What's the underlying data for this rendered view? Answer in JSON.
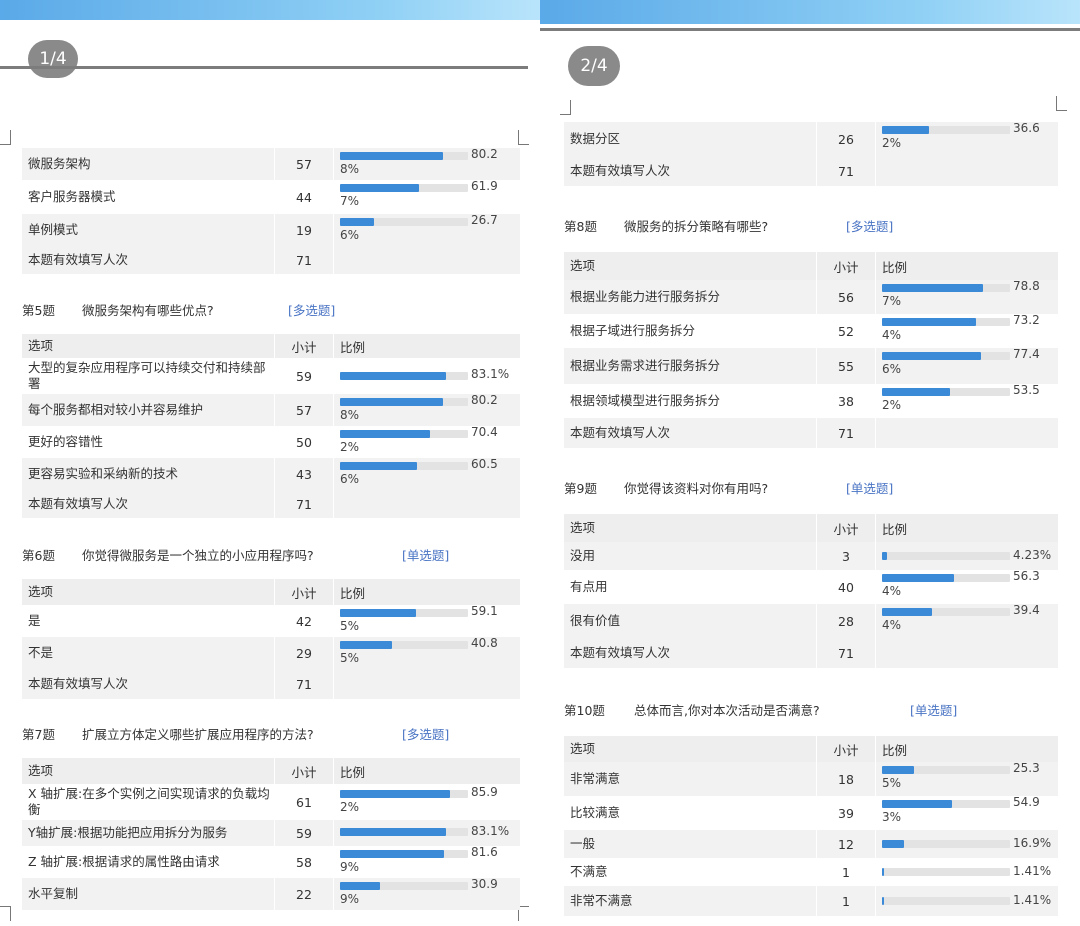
{
  "page1": {
    "page_number": "1/4",
    "sections": [
      {
        "rows": [
          {
            "option": "微服务架构",
            "count": "57",
            "pct": "80.2",
            "pct_tail": "8%",
            "fill": 0.802
          },
          {
            "option": "客户服务器模式",
            "count": "44",
            "pct": "61.9",
            "pct_tail": "7%",
            "fill": 0.619
          },
          {
            "option": "单例模式",
            "count": "19",
            "pct": "26.7",
            "pct_tail": "6%",
            "fill": 0.267
          }
        ],
        "total_label": "本题有效填写人次",
        "total": "71"
      },
      {
        "number": "第5题",
        "title": "微服务架构有哪些优点?",
        "type": "[多选题]",
        "header": {
          "option": "选项",
          "count": "小计",
          "ratio": "比例"
        },
        "rows": [
          {
            "option": "大型的复杂应用程序可以持续交付和持续部署",
            "count": "59",
            "pct": "83.1%",
            "pct_tail": "",
            "fill": 0.831
          },
          {
            "option": "每个服务都相对较小并容易维护",
            "count": "57",
            "pct": "80.2",
            "pct_tail": "8%",
            "fill": 0.802
          },
          {
            "option": "更好的容错性",
            "count": "50",
            "pct": "70.4",
            "pct_tail": "2%",
            "fill": 0.704
          },
          {
            "option": "更容易实验和采纳新的技术",
            "count": "43",
            "pct": "60.5",
            "pct_tail": "6%",
            "fill": 0.605
          }
        ],
        "total_label": "本题有效填写人次",
        "total": "71"
      },
      {
        "number": "第6题",
        "title": "你觉得微服务是一个独立的小应用程序吗?",
        "type": "[单选题]",
        "header": {
          "option": "选项",
          "count": "小计",
          "ratio": "比例"
        },
        "rows": [
          {
            "option": "是",
            "count": "42",
            "pct": "59.1",
            "pct_tail": "5%",
            "fill": 0.591
          },
          {
            "option": "不是",
            "count": "29",
            "pct": "40.8",
            "pct_tail": "5%",
            "fill": 0.408
          }
        ],
        "total_label": "本题有效填写人次",
        "total": "71"
      },
      {
        "number": "第7题",
        "title": "扩展立方体定义哪些扩展应用程序的方法?",
        "type": "[多选题]",
        "header": {
          "option": "选项",
          "count": "小计",
          "ratio": "比例"
        },
        "rows": [
          {
            "option": "X 轴扩展:在多个实例之间实现请求的负载均衡",
            "count": "61",
            "pct": "85.9",
            "pct_tail": "2%",
            "fill": 0.859
          },
          {
            "option": "Y轴扩展:根据功能把应用拆分为服务",
            "count": "59",
            "pct": "83.1%",
            "pct_tail": "",
            "fill": 0.831
          },
          {
            "option": "Z 轴扩展:根据请求的属性路由请求",
            "count": "58",
            "pct": "81.6",
            "pct_tail": "9%",
            "fill": 0.816
          },
          {
            "option": "水平复制",
            "count": "22",
            "pct": "30.9",
            "pct_tail": "9%",
            "fill": 0.309
          }
        ]
      }
    ]
  },
  "page2": {
    "page_number": "2/4",
    "sections": [
      {
        "rows": [
          {
            "option": "数据分区",
            "count": "26",
            "pct": "36.6",
            "pct_tail": "2%",
            "fill": 0.366
          }
        ],
        "total_label": "本题有效填写人次",
        "total": "71"
      },
      {
        "number": "第8题",
        "title": "微服务的拆分策略有哪些?",
        "type": "[多选题]",
        "header": {
          "option": "选项",
          "count": "小计",
          "ratio": "比例"
        },
        "rows": [
          {
            "option": "根据业务能力进行服务拆分",
            "count": "56",
            "pct": "78.8",
            "pct_tail": "7%",
            "fill": 0.788
          },
          {
            "option": "根据子域进行服务拆分",
            "count": "52",
            "pct": "73.2",
            "pct_tail": "4%",
            "fill": 0.732
          },
          {
            "option": "根据业务需求进行服务拆分",
            "count": "55",
            "pct": "77.4",
            "pct_tail": "6%",
            "fill": 0.774
          },
          {
            "option": "根据领域模型进行服务拆分",
            "count": "38",
            "pct": "53.5",
            "pct_tail": "2%",
            "fill": 0.535
          }
        ],
        "total_label": "本题有效填写人次",
        "total": "71"
      },
      {
        "number": "第9题",
        "title": "你觉得该资料对你有用吗?",
        "type": "[单选题]",
        "header": {
          "option": "选项",
          "count": "小计",
          "ratio": "比例"
        },
        "rows": [
          {
            "option": "没用",
            "count": "3",
            "pct": "4.23%",
            "pct_tail": "",
            "fill": 0.0423
          },
          {
            "option": "有点用",
            "count": "40",
            "pct": "56.3",
            "pct_tail": "4%",
            "fill": 0.563
          },
          {
            "option": "很有价值",
            "count": "28",
            "pct": "39.4",
            "pct_tail": "4%",
            "fill": 0.394
          }
        ],
        "total_label": "本题有效填写人次",
        "total": "71"
      },
      {
        "number": "第10题",
        "title": "总体而言,你对本次活动是否满意?",
        "type": "[单选题]",
        "header": {
          "option": "选项",
          "count": "小计",
          "ratio": "比例"
        },
        "rows": [
          {
            "option": "非常满意",
            "count": "18",
            "pct": "25.3",
            "pct_tail": "5%",
            "fill": 0.253
          },
          {
            "option": "比较满意",
            "count": "39",
            "pct": "54.9",
            "pct_tail": "3%",
            "fill": 0.549
          },
          {
            "option": "一般",
            "count": "12",
            "pct": "16.9%",
            "pct_tail": "",
            "fill": 0.169
          },
          {
            "option": "不满意",
            "count": "1",
            "pct": "1.41%",
            "pct_tail": "",
            "fill": 0.0141
          },
          {
            "option": "非常不满意",
            "count": "1",
            "pct": "1.41%",
            "pct_tail": "",
            "fill": 0.0141
          }
        ]
      }
    ]
  }
}
